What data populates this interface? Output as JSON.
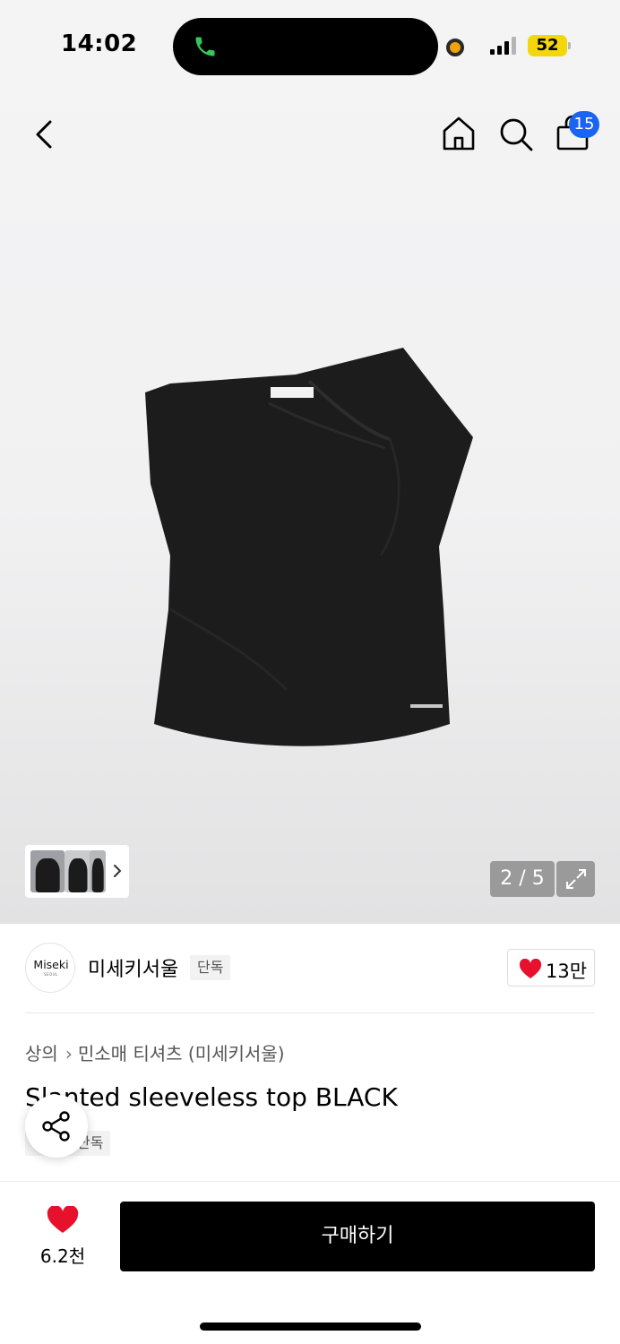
{
  "status_bar": {
    "time": "14:02",
    "battery": "52",
    "icons": [
      "phone-call-icon",
      "signal-icon"
    ],
    "colors": {
      "call": "#34c759",
      "battery": "#f5d60a",
      "indicator": "#f2a20c"
    }
  },
  "nav": {
    "icons": [
      "back-arrow-icon",
      "home-icon",
      "search-icon",
      "shopping-bag-icon"
    ],
    "cart_badge": "15",
    "badge_color": "#1b64f2"
  },
  "gallery": {
    "counter": "2 / 5",
    "thumbnail_icons": [
      "chevron-right-icon",
      "expand-icon"
    ]
  },
  "brand": {
    "logo_text": "Miseki",
    "logo_subtext": "SEOUL",
    "name": "미세키서울",
    "exclusive_label": "단독",
    "like_count": "13만",
    "heart_color": "#e8112d"
  },
  "product": {
    "breadcrumb": [
      "상의",
      "민소매 티셔츠 (미세키서울)"
    ],
    "title": "Slanted sleeveless top BLACK",
    "exclusive_label": "단독"
  },
  "bottom_bar": {
    "wish_count": "6.2천",
    "buy_label": "구매하기"
  }
}
